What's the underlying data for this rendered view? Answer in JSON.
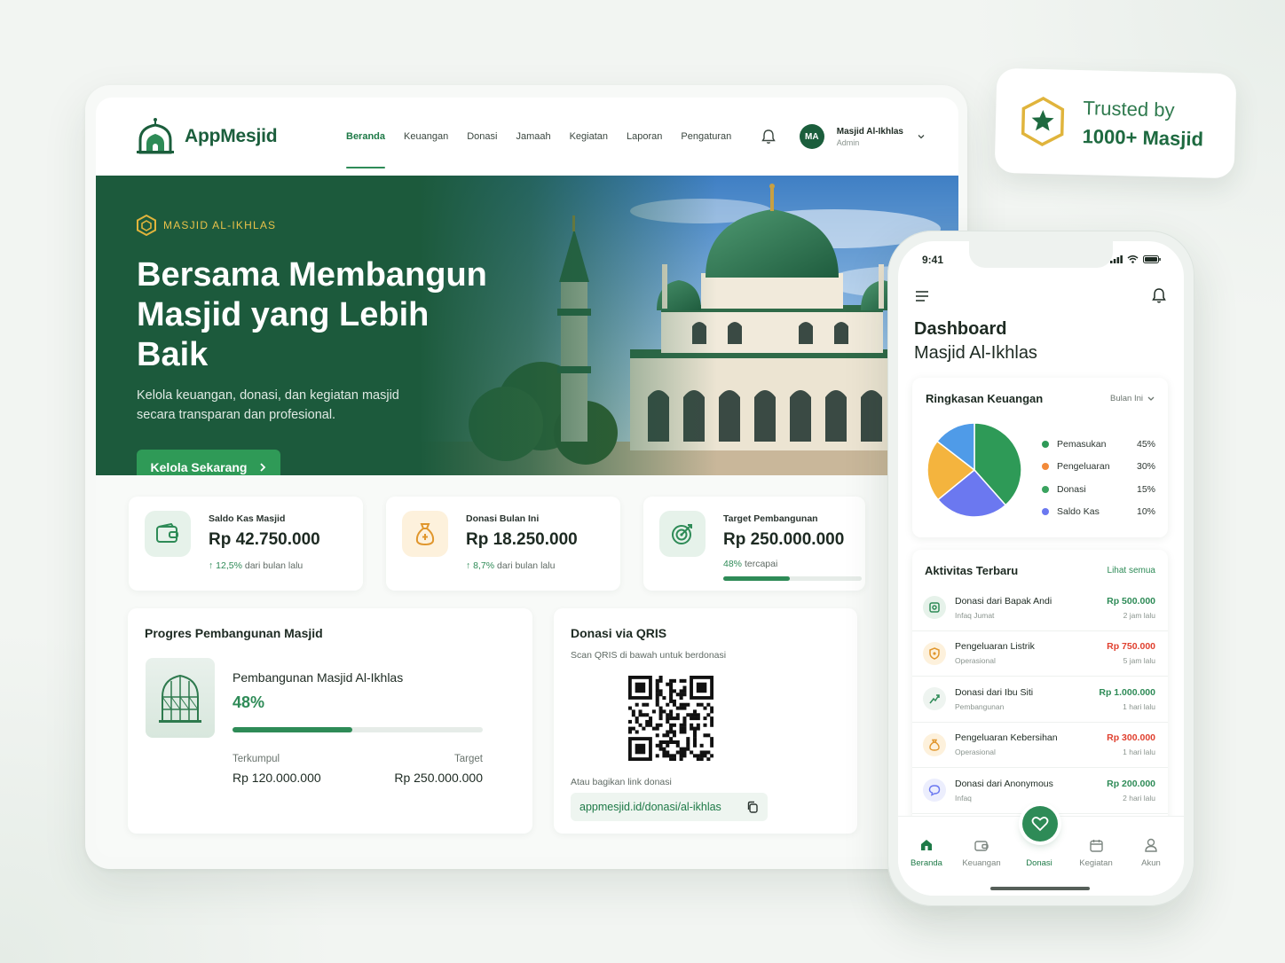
{
  "desktop": {
    "brand": "AppMesjid",
    "nav": [
      "Beranda",
      "Keuangan",
      "Donasi",
      "Jamaah",
      "Kegiatan",
      "Laporan",
      "Pengaturan"
    ],
    "user": {
      "initials": "MA",
      "name": "Masjid Al-Ikhlas",
      "role": "Admin"
    },
    "hero": {
      "badge": "MASJID AL-IKHLAS",
      "title": "Bersama Membangun Masjid yang Lebih Baik",
      "subtitle": "Kelola keuangan, donasi, dan kegiatan masjid secara transparan dan profesional.",
      "cta": "Kelola Sekarang"
    },
    "stats": [
      {
        "label": "Saldo Kas Masjid",
        "value": "Rp 42.750.000",
        "trend_pct": "12,5%",
        "trend_text": "dari bulan lalu"
      },
      {
        "label": "Donasi Bulan Ini",
        "value": "Rp 18.250.000",
        "trend_pct": "8,7%",
        "trend_text": "dari bulan lalu"
      },
      {
        "label": "Target Pembangunan",
        "value": "Rp 250.000.000",
        "trend_pct": "48%",
        "trend_text": "tercapai",
        "progress": 0.48
      }
    ],
    "progress": {
      "title": "Progres Pembangunan Masjid",
      "project": "Pembangunan Masjid Al-Ikhlas",
      "percent": "48%",
      "progress": 0.48,
      "collected_label": "Terkumpul",
      "collected": "Rp 120.000.000",
      "target_label": "Target",
      "target": "Rp 250.000.000"
    },
    "qris": {
      "title": "Donasi via QRIS",
      "subtitle": "Scan QRIS di bawah untuk berdonasi",
      "link_label": "Atau bagikan link donasi",
      "link": "appmesjid.id/donasi/al-ikhlas"
    }
  },
  "trusted": {
    "line1": "Trusted by",
    "line2": "1000+ Masjid"
  },
  "phone": {
    "time": "9:41",
    "title_1": "Dashboard",
    "title_2": "Masjid Al-Ikhlas",
    "finance": {
      "title": "Ringkasan Keuangan",
      "period": "Bulan Ini",
      "legend": [
        {
          "name": "Pemasukan",
          "pct": "45%",
          "color": "#2e9a57"
        },
        {
          "name": "Pengeluaran",
          "pct": "30%",
          "color": "#f28a3a"
        },
        {
          "name": "Donasi",
          "pct": "15%",
          "color": "#3aa35f"
        },
        {
          "name": "Saldo Kas",
          "pct": "10%",
          "color": "#6b78f0"
        }
      ]
    },
    "activity": {
      "title": "Aktivitas Terbaru",
      "see_all": "Lihat semua",
      "items": [
        {
          "title": "Donasi dari Bapak Andi",
          "category": "Infaq Jumat",
          "amount": "Rp 500.000",
          "time": "2 jam lalu",
          "type": "in"
        },
        {
          "title": "Pengeluaran Listrik",
          "category": "Operasional",
          "amount": "Rp 750.000",
          "time": "5 jam lalu",
          "type": "out"
        },
        {
          "title": "Donasi dari Ibu Siti",
          "category": "Pembangunan",
          "amount": "Rp 1.000.000",
          "time": "1 hari lalu",
          "type": "in"
        },
        {
          "title": "Pengeluaran Kebersihan",
          "category": "Operasional",
          "amount": "Rp 300.000",
          "time": "1 hari lalu",
          "type": "out"
        },
        {
          "title": "Donasi dari Anonymous",
          "category": "Infaq",
          "amount": "Rp 200.000",
          "time": "2 hari lalu",
          "type": "in"
        }
      ]
    },
    "tabs": [
      "Beranda",
      "Keuangan",
      "Donasi",
      "Kegiatan",
      "Akun"
    ]
  },
  "colors": {
    "primary": "#1b5e3c",
    "accent": "#2e8b57",
    "gold": "#e0b43c",
    "expense": "#e0402f"
  }
}
